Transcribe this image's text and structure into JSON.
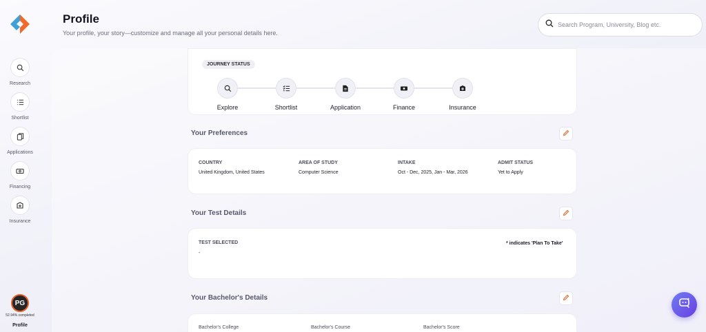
{
  "header": {
    "title": "Profile",
    "subtitle": "Your profile, your story—customize and manage all your personal details here."
  },
  "search": {
    "placeholder": "Search Program, University, Blog etc."
  },
  "sidebar": {
    "items": [
      {
        "label": "Research",
        "icon": "search-icon"
      },
      {
        "label": "Shortlist",
        "icon": "list-icon"
      },
      {
        "label": "Applications",
        "icon": "documents-icon"
      },
      {
        "label": "Financing",
        "icon": "money-icon"
      },
      {
        "label": "Insurance",
        "icon": "insurance-icon"
      }
    ],
    "profile": {
      "initials": "PG",
      "completion": "52.94% completed",
      "label": "Profile"
    }
  },
  "journey": {
    "badge": "JOURNEY STATUS",
    "steps": [
      {
        "label": "Explore",
        "icon": "search-icon"
      },
      {
        "label": "Shortlist",
        "icon": "checklist-icon"
      },
      {
        "label": "Application",
        "icon": "document-icon"
      },
      {
        "label": "Finance",
        "icon": "money-icon"
      },
      {
        "label": "Insurance",
        "icon": "insurance-icon"
      }
    ]
  },
  "preferences": {
    "title": "Your Preferences",
    "fields": [
      {
        "label": "COUNTRY",
        "value": "United Kingdom, United States"
      },
      {
        "label": "AREA OF STUDY",
        "value": "Computer Science"
      },
      {
        "label": "INTAKE",
        "value": "Oct - Dec, 2025, Jan - Mar, 2026"
      },
      {
        "label": "ADMIT STATUS",
        "value": "Yet to Apply"
      }
    ]
  },
  "test_details": {
    "title": "Your Test Details",
    "label": "TEST SELECTED",
    "value": "-",
    "note": "* indicates 'Plan To Take'"
  },
  "bachelors": {
    "title": "Your Bachelor's Details",
    "fields": [
      {
        "label": "Bachelor's College"
      },
      {
        "label": "Bachelor's Course"
      },
      {
        "label": "Bachelor's Score"
      }
    ]
  },
  "colors": {
    "accent": "#e4602a",
    "chat": "#6a4fe6"
  }
}
